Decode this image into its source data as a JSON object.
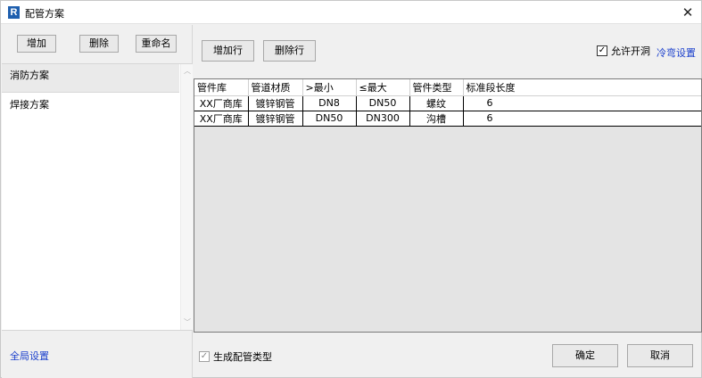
{
  "window": {
    "title": "配管方案",
    "app_icon_letter": "R",
    "close_glyph": "✕"
  },
  "left_toolbar": {
    "add_label": "增加",
    "delete_label": "删除",
    "rename_label": "重命名"
  },
  "schemes": [
    {
      "label": "消防方案",
      "selected": true
    },
    {
      "label": "焊接方案",
      "selected": false
    }
  ],
  "global_settings_label": "全局设置",
  "right_toolbar": {
    "add_row_label": "增加行",
    "delete_row_label": "删除行",
    "allow_opening_label": "允许开洞",
    "allow_opening_checked": true,
    "bend_settings_label": "冷弯设置"
  },
  "grid": {
    "columns": [
      "管件库",
      "管道材质",
      ">最小",
      "≤最大",
      "管件类型",
      "标准段长度"
    ],
    "rows": [
      [
        "XX厂商库",
        "镀锌钢管",
        "DN8",
        "DN50",
        "螺纹",
        "6"
      ],
      [
        "XX厂商库",
        "镀锌钢管",
        "DN50",
        "DN300",
        "沟槽",
        "6"
      ]
    ]
  },
  "footer": {
    "generate_label": "生成配管类型",
    "generate_checked": true,
    "ok_label": "确定",
    "cancel_label": "取消"
  },
  "colors": {
    "link": "#1a3fcc",
    "app_icon": "#1f5fae"
  }
}
